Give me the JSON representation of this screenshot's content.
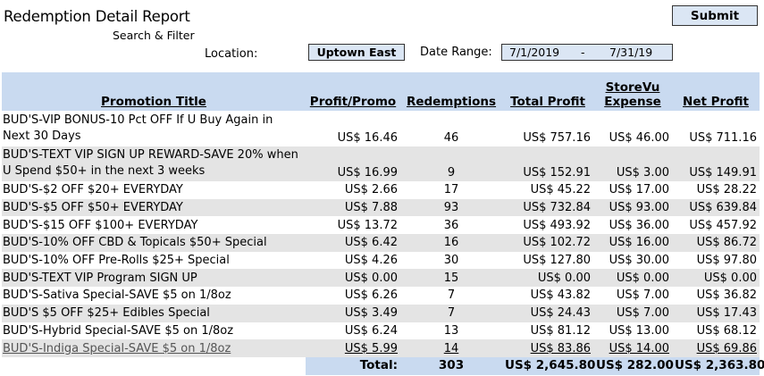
{
  "header": {
    "title": "Redemption Detail Report",
    "subtitle": "Search & Filter",
    "submit_label": "Submit"
  },
  "filters": {
    "location_label": "Location:",
    "location_value": "Uptown East",
    "date_label": "Date Range:",
    "date_from": "7/1/2019",
    "date_separator": "-",
    "date_to": "7/31/19"
  },
  "table": {
    "columns": {
      "promo": "Promotion Title",
      "profit_promo": "Profit/Promo",
      "redemptions": "Redemptions",
      "total_profit": "Total Profit",
      "expense_line1": "StoreVu",
      "expense_line2": "Expense",
      "net_profit": "Net Profit"
    },
    "rows": [
      {
        "title": "BUD'S-VIP BONUS-10 Pct OFF If U Buy Again in Next 30 Days",
        "profit_promo": "US$ 16.46",
        "redemptions": "46",
        "total_profit": "US$ 757.16",
        "expense": "US$ 46.00",
        "net": "US$ 711.16"
      },
      {
        "title": "BUD'S-TEXT VIP SIGN UP REWARD-SAVE 20% when U Spend $50+ in the next 3 weeks",
        "profit_promo": "US$ 16.99",
        "redemptions": "9",
        "total_profit": "US$ 152.91",
        "expense": "US$ 3.00",
        "net": "US$ 149.91"
      },
      {
        "title": "BUD'S-$2 OFF $20+ EVERYDAY",
        "profit_promo": "US$ 2.66",
        "redemptions": "17",
        "total_profit": "US$ 45.22",
        "expense": "US$ 17.00",
        "net": "US$ 28.22"
      },
      {
        "title": "BUD'S-$5 OFF $50+  EVERYDAY",
        "profit_promo": "US$ 7.88",
        "redemptions": "93",
        "total_profit": "US$ 732.84",
        "expense": "US$ 93.00",
        "net": "US$ 639.84"
      },
      {
        "title": "BUD'S-$15 OFF $100+  EVERYDAY",
        "profit_promo": "US$ 13.72",
        "redemptions": "36",
        "total_profit": "US$ 493.92",
        "expense": "US$ 36.00",
        "net": "US$ 457.92"
      },
      {
        "title": "BUD'S-10% OFF CBD & Topicals $50+ Special",
        "profit_promo": "US$ 6.42",
        "redemptions": "16",
        "total_profit": "US$ 102.72",
        "expense": "US$ 16.00",
        "net": "US$ 86.72"
      },
      {
        "title": "BUD'S-10% OFF Pre-Rolls $25+ Special",
        "profit_promo": "US$ 4.26",
        "redemptions": "30",
        "total_profit": "US$ 127.80",
        "expense": "US$ 30.00",
        "net": "US$ 97.80"
      },
      {
        "title": "BUD'S-TEXT VIP Program SIGN UP",
        "profit_promo": "US$ 0.00",
        "redemptions": "15",
        "total_profit": "US$ 0.00",
        "expense": "US$ 0.00",
        "net": "US$ 0.00"
      },
      {
        "title": "BUD'S-Sativa Special-SAVE $5 on 1/8oz",
        "profit_promo": "US$ 6.26",
        "redemptions": "7",
        "total_profit": "US$ 43.82",
        "expense": "US$ 7.00",
        "net": "US$ 36.82"
      },
      {
        "title": "BUD'S $5 OFF $25+ Edibles Special",
        "profit_promo": "US$ 3.49",
        "redemptions": "7",
        "total_profit": "US$ 24.43",
        "expense": "US$ 7.00",
        "net": "US$ 17.43"
      },
      {
        "title": "BUD'S-Hybrid Special-SAVE $5 on 1/8oz",
        "profit_promo": "US$ 6.24",
        "redemptions": "13",
        "total_profit": "US$ 81.12",
        "expense": "US$ 13.00",
        "net": "US$ 68.12"
      },
      {
        "title": "BUD'S-Indiga Special-SAVE $5 on 1/8oz",
        "profit_promo": "US$ 5.99",
        "redemptions": "14",
        "total_profit": "US$ 83.86",
        "expense": "US$ 14.00",
        "net": "US$ 69.86"
      }
    ],
    "total": {
      "label": "Total:",
      "redemptions": "303",
      "total_profit": "US$ 2,645.80",
      "expense": "US$ 282.00",
      "net": "US$ 2,363.80"
    }
  },
  "colors": {
    "header_blue": "#c9daf0",
    "button_blue": "#dbe6f4",
    "row_gray": "#e4e4e4"
  }
}
